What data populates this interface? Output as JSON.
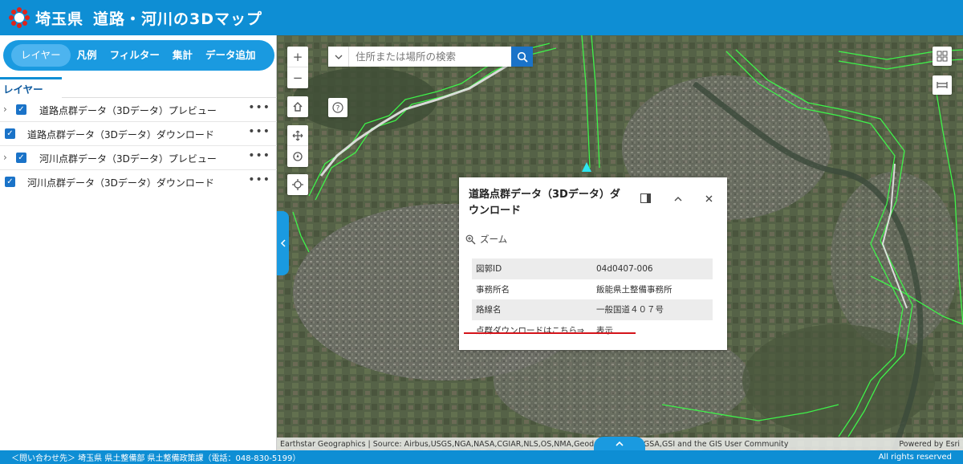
{
  "header": {
    "brand": "埼玉県",
    "title": "道路・河川の3Dマップ",
    "logo_icon": "saitama-prefecture-emblem-icon",
    "bg_color": "#0e8ed4"
  },
  "sidebar": {
    "tabs": [
      {
        "label": "レイヤー",
        "active": true
      },
      {
        "label": "凡例",
        "active": false
      },
      {
        "label": "フィルター",
        "active": false
      },
      {
        "label": "集計",
        "active": false
      },
      {
        "label": "データ追加",
        "active": false
      }
    ],
    "subtab_label": "レイヤー",
    "layers": [
      {
        "label": "道路点群データ（3Dデータ）プレビュー",
        "checked": true,
        "expandable": true
      },
      {
        "label": "道路点群データ（3Dデータ）ダウンロード",
        "checked": true,
        "expandable": false
      },
      {
        "label": "河川点群データ（3Dデータ）プレビュー",
        "checked": true,
        "expandable": true
      },
      {
        "label": "河川点群データ（3Dデータ）ダウンロード",
        "checked": true,
        "expandable": false
      }
    ]
  },
  "map": {
    "search_placeholder": "住所または場所の検索",
    "zoom_in": "+",
    "zoom_out": "−",
    "help": "?",
    "popup": {
      "title": "道路点群データ（3Dデータ）ダウンロード",
      "zoom_label": "ズーム",
      "rows": [
        {
          "key": "図郭ID",
          "value": "04d0407-006"
        },
        {
          "key": "事務所名",
          "value": "飯能県土整備事務所"
        },
        {
          "key": "路線名",
          "value": "一般国道４０７号"
        },
        {
          "key": "点群ダウンロードはこちら⇒",
          "value": "表示"
        }
      ]
    },
    "attribution": "Earthstar Geographics | Source: Airbus,USGS,NGA,NASA,CGIAR,NLS,OS,NMA,Geodatastyrelsen,GSA,GSI and the GIS User Community",
    "powered_by": "Powered by Esri"
  },
  "footer": {
    "contact": "＜問い合わせ先＞ 埼玉県 県土整備部 県土整備政策課（電話：048-830-5199）",
    "rights": "All rights reserved"
  }
}
